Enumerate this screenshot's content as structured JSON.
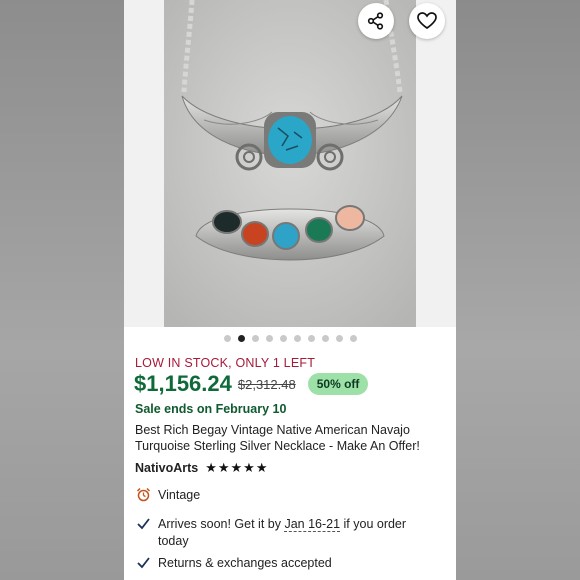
{
  "gallery": {
    "total_images": 10,
    "active_index": 1
  },
  "icons": {
    "share": "share-icon",
    "favorite": "heart-icon",
    "vintage": "alarm-clock-icon",
    "check": "check-icon"
  },
  "listing": {
    "stock_notice": "LOW IN STOCK, ONLY 1 LEFT",
    "price": "$1,156.24",
    "original_price": "$2,312.48",
    "discount": "50% off",
    "sale_ends": "Sale ends on February 10",
    "title": "Best Rich Begay Vintage Native American Navajo Turquoise Sterling Silver Necklace - Make An Offer!",
    "seller": "NativoArts",
    "rating_stars": "★★★★★",
    "vintage_label": "Vintage",
    "arrival_prefix": "Arrives soon! Get it by ",
    "arrival_dates": "Jan 16-21",
    "arrival_suffix": " if you order today",
    "returns": "Returns & exchanges accepted"
  },
  "colors": {
    "price_green": "#0f6a39",
    "stock_red": "#a61a3a",
    "badge_bg": "#9de0a8"
  }
}
